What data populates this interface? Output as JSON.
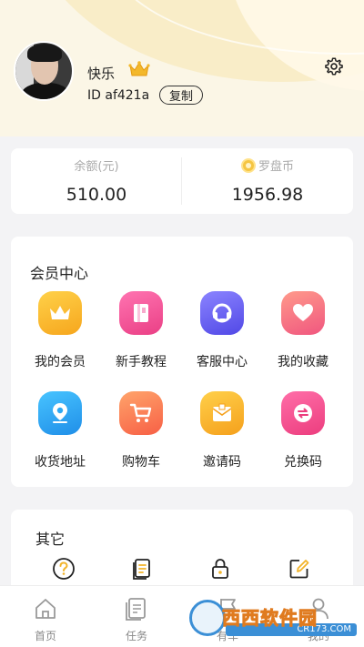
{
  "profile": {
    "username": "快乐",
    "user_id": "ID af421a",
    "copy_label": "复制"
  },
  "balance": {
    "left_label": "余额(元)",
    "left_value": "510.00",
    "right_label": "罗盘币",
    "right_value": "1956.98"
  },
  "member_center": {
    "title": "会员中心",
    "items": [
      {
        "label": "我的会员",
        "icon": "crown-icon",
        "color": "#f8b92a"
      },
      {
        "label": "新手教程",
        "icon": "book-icon",
        "color": "#f0569a"
      },
      {
        "label": "客服中心",
        "icon": "headset-icon",
        "color": "#6b63f2"
      },
      {
        "label": "我的收藏",
        "icon": "heart-icon",
        "color": "#f56f88"
      },
      {
        "label": "收货地址",
        "icon": "location-icon",
        "color": "#2ea8f2"
      },
      {
        "label": "购物车",
        "icon": "cart-icon",
        "color": "#fb7d57"
      },
      {
        "label": "邀请码",
        "icon": "envelope-icon",
        "color": "#f9b62a"
      },
      {
        "label": "兑换码",
        "icon": "exchange-icon",
        "color": "#f2528f"
      }
    ]
  },
  "other": {
    "title": "其它",
    "items": [
      {
        "icon": "question-icon"
      },
      {
        "icon": "document-icon"
      },
      {
        "icon": "lock-icon"
      },
      {
        "icon": "edit-icon"
      }
    ]
  },
  "tabbar": {
    "tabs": [
      {
        "label": "首页",
        "icon": "home-icon"
      },
      {
        "label": "任务",
        "icon": "task-icon"
      },
      {
        "label": "有车",
        "icon": "flag-icon"
      },
      {
        "label": "我的",
        "icon": "user-icon"
      }
    ]
  },
  "watermark": {
    "text": "西西软件园",
    "sub": "CR173.COM"
  }
}
